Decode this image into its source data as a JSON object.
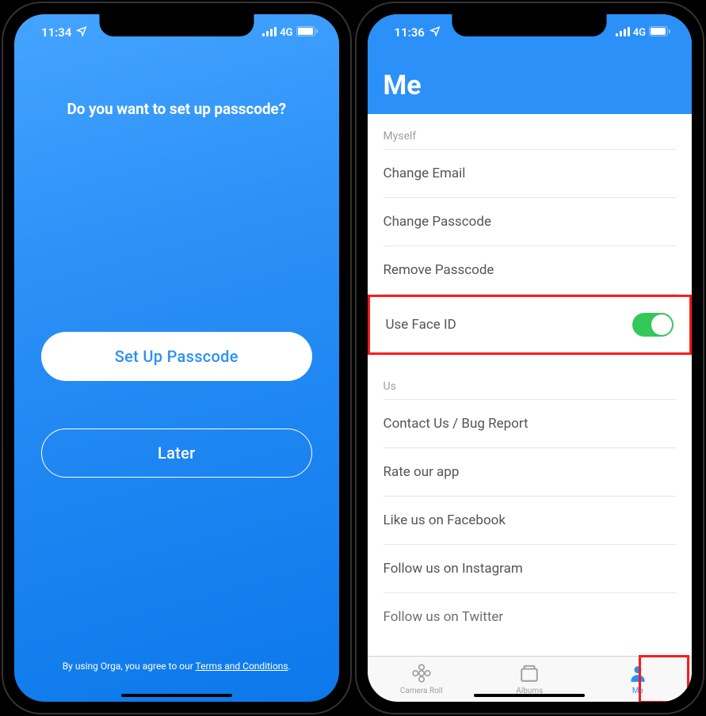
{
  "left": {
    "status": {
      "time": "11:34",
      "network": "4G"
    },
    "prompt": "Do you want to set up passcode?",
    "buttons": {
      "primary": "Set Up Passcode",
      "secondary": "Later"
    },
    "terms_prefix": "By using Orga, you agree to our ",
    "terms_link": "Terms and Conditions",
    "terms_suffix": "."
  },
  "right": {
    "status": {
      "time": "11:36",
      "network": "4G"
    },
    "header_title": "Me",
    "section_myself": "Myself",
    "rows_myself": {
      "change_email": "Change Email",
      "change_passcode": "Change Passcode",
      "remove_passcode": "Remove Passcode",
      "use_face_id": "Use Face ID"
    },
    "face_id_enabled": true,
    "section_us": "Us",
    "rows_us": {
      "contact": "Contact Us / Bug Report",
      "rate": "Rate our app",
      "facebook": "Like us on Facebook",
      "instagram": "Follow us on Instagram",
      "twitter": "Follow us on Twitter"
    },
    "tabs": {
      "camera_roll": "Camera Roll",
      "albums": "Albums",
      "me": "Me"
    }
  },
  "colors": {
    "accent": "#2b90f7",
    "highlight": "#ff1a1a",
    "toggle_on": "#34c759"
  }
}
